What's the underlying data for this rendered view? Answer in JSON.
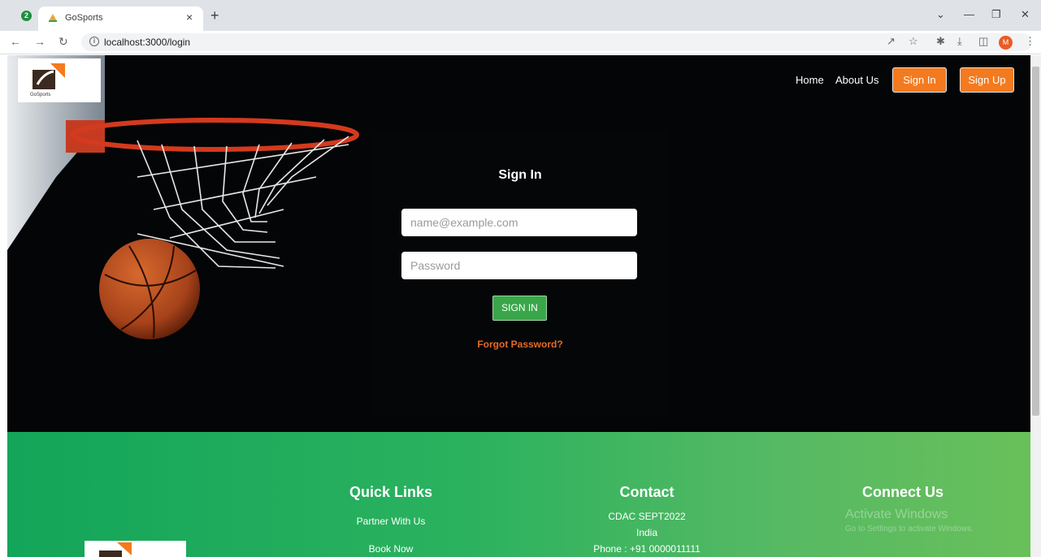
{
  "browser": {
    "tab_count_badge": "2",
    "tab_title": "GoSports",
    "tab_close": "×",
    "new_tab": "+",
    "url": "localhost:3000/login",
    "avatar_letter": "M",
    "accent": "#f47a1f"
  },
  "header": {
    "logo_text": "GoSports",
    "nav": {
      "home": "Home",
      "about": "About Us",
      "sign_in": "Sign In",
      "sign_up": "Sign Up"
    }
  },
  "signin_form": {
    "title": "Sign In",
    "email_placeholder": "name@example.com",
    "password_placeholder": "Password",
    "submit_label": "SIGN IN",
    "forgot_label": "Forgot Password?"
  },
  "footer": {
    "quick_links": {
      "heading": "Quick Links",
      "items": [
        "Partner With Us",
        "Book Now"
      ]
    },
    "contact": {
      "heading": "Contact",
      "lines": [
        "CDAC SEPT2022",
        "India",
        "Phone : +91 0000011111"
      ]
    },
    "connect": {
      "heading": "Connect Us"
    },
    "watermark": {
      "line1": "Activate Windows",
      "line2": "Go to Settings to activate Windows."
    }
  },
  "colors": {
    "brand_orange": "#f47a1f",
    "signin_green": "#3aa64a",
    "footer_green": "#2bb25e",
    "forgot_orange": "#e46b25"
  }
}
